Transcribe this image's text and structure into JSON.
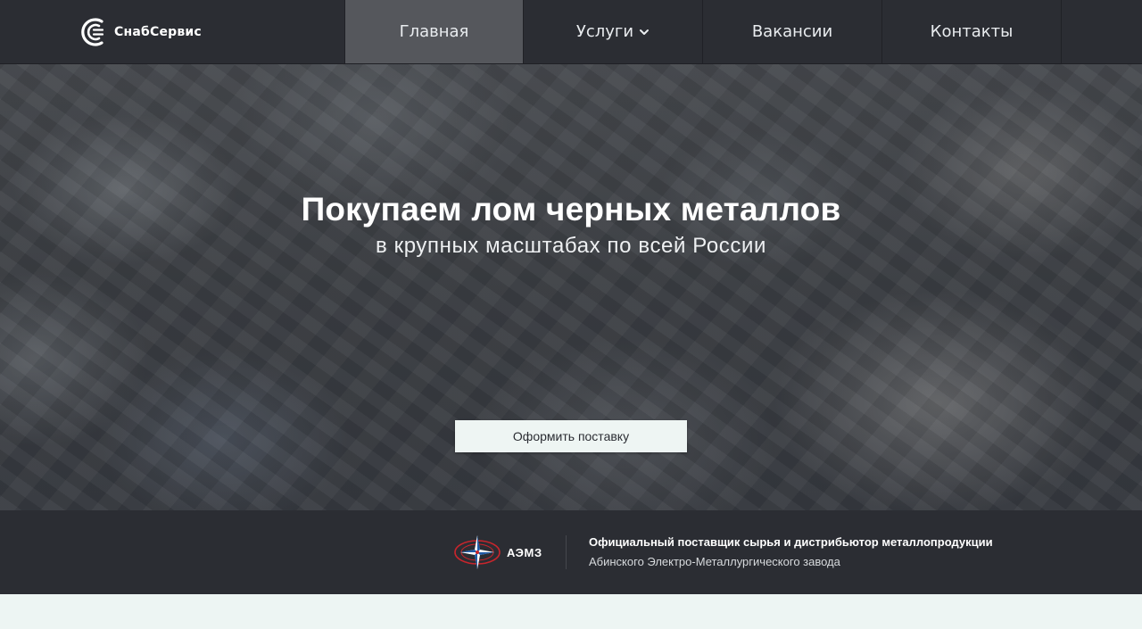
{
  "header": {
    "logo_text": "СнабСервис",
    "nav": [
      {
        "label": "Главная",
        "active": true
      },
      {
        "label": "Услуги",
        "has_dropdown": true
      },
      {
        "label": "Вакансии"
      },
      {
        "label": "Контакты"
      }
    ]
  },
  "hero": {
    "title": "Покупаем лом черных металлов",
    "subtitle": "в крупных масштабах по всей России",
    "cta_label": "Оформить поставку"
  },
  "partner": {
    "abbr": "АЭМЗ",
    "line1": "Официальный поставщик сырья и дистрибьютор металлопродукции",
    "line2": "Абинского Электро-Металлургического завода"
  },
  "colors": {
    "header_bg": "#2b2d33",
    "nav_active_bg": "#55575c",
    "cta_bg": "#eef5f3",
    "page_bg": "#edf5f3",
    "partner_emblem_red": "#c8252c",
    "partner_emblem_blue": "#1f5aa6"
  },
  "icons": {
    "logo": "snabservis-logo-icon",
    "dropdown": "chevron-down-icon",
    "partner": "aemz-emblem-icon"
  }
}
